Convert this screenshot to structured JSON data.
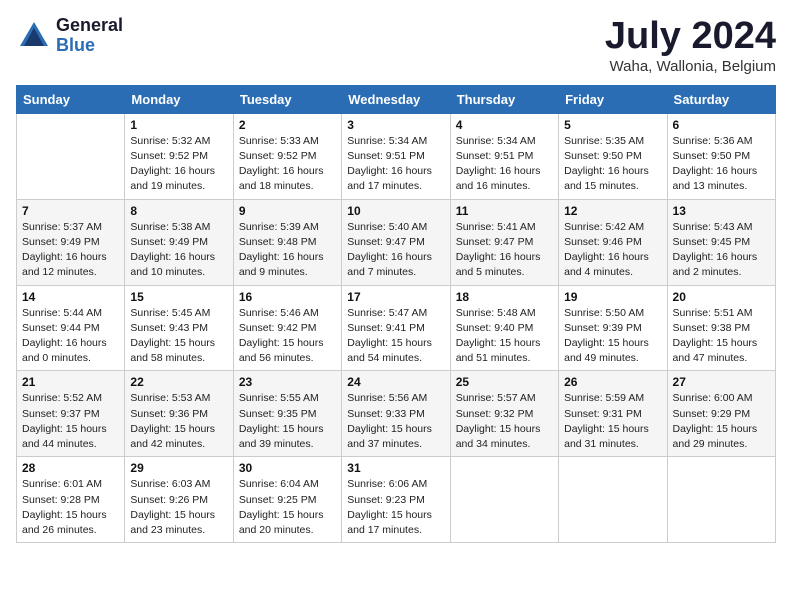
{
  "header": {
    "logo_general": "General",
    "logo_blue": "Blue",
    "title": "July 2024",
    "subtitle": "Waha, Wallonia, Belgium"
  },
  "weekdays": [
    "Sunday",
    "Monday",
    "Tuesday",
    "Wednesday",
    "Thursday",
    "Friday",
    "Saturday"
  ],
  "weeks": [
    [
      {
        "day": "",
        "info": ""
      },
      {
        "day": "1",
        "info": "Sunrise: 5:32 AM\nSunset: 9:52 PM\nDaylight: 16 hours\nand 19 minutes."
      },
      {
        "day": "2",
        "info": "Sunrise: 5:33 AM\nSunset: 9:52 PM\nDaylight: 16 hours\nand 18 minutes."
      },
      {
        "day": "3",
        "info": "Sunrise: 5:34 AM\nSunset: 9:51 PM\nDaylight: 16 hours\nand 17 minutes."
      },
      {
        "day": "4",
        "info": "Sunrise: 5:34 AM\nSunset: 9:51 PM\nDaylight: 16 hours\nand 16 minutes."
      },
      {
        "day": "5",
        "info": "Sunrise: 5:35 AM\nSunset: 9:50 PM\nDaylight: 16 hours\nand 15 minutes."
      },
      {
        "day": "6",
        "info": "Sunrise: 5:36 AM\nSunset: 9:50 PM\nDaylight: 16 hours\nand 13 minutes."
      }
    ],
    [
      {
        "day": "7",
        "info": "Sunrise: 5:37 AM\nSunset: 9:49 PM\nDaylight: 16 hours\nand 12 minutes."
      },
      {
        "day": "8",
        "info": "Sunrise: 5:38 AM\nSunset: 9:49 PM\nDaylight: 16 hours\nand 10 minutes."
      },
      {
        "day": "9",
        "info": "Sunrise: 5:39 AM\nSunset: 9:48 PM\nDaylight: 16 hours\nand 9 minutes."
      },
      {
        "day": "10",
        "info": "Sunrise: 5:40 AM\nSunset: 9:47 PM\nDaylight: 16 hours\nand 7 minutes."
      },
      {
        "day": "11",
        "info": "Sunrise: 5:41 AM\nSunset: 9:47 PM\nDaylight: 16 hours\nand 5 minutes."
      },
      {
        "day": "12",
        "info": "Sunrise: 5:42 AM\nSunset: 9:46 PM\nDaylight: 16 hours\nand 4 minutes."
      },
      {
        "day": "13",
        "info": "Sunrise: 5:43 AM\nSunset: 9:45 PM\nDaylight: 16 hours\nand 2 minutes."
      }
    ],
    [
      {
        "day": "14",
        "info": "Sunrise: 5:44 AM\nSunset: 9:44 PM\nDaylight: 16 hours\nand 0 minutes."
      },
      {
        "day": "15",
        "info": "Sunrise: 5:45 AM\nSunset: 9:43 PM\nDaylight: 15 hours\nand 58 minutes."
      },
      {
        "day": "16",
        "info": "Sunrise: 5:46 AM\nSunset: 9:42 PM\nDaylight: 15 hours\nand 56 minutes."
      },
      {
        "day": "17",
        "info": "Sunrise: 5:47 AM\nSunset: 9:41 PM\nDaylight: 15 hours\nand 54 minutes."
      },
      {
        "day": "18",
        "info": "Sunrise: 5:48 AM\nSunset: 9:40 PM\nDaylight: 15 hours\nand 51 minutes."
      },
      {
        "day": "19",
        "info": "Sunrise: 5:50 AM\nSunset: 9:39 PM\nDaylight: 15 hours\nand 49 minutes."
      },
      {
        "day": "20",
        "info": "Sunrise: 5:51 AM\nSunset: 9:38 PM\nDaylight: 15 hours\nand 47 minutes."
      }
    ],
    [
      {
        "day": "21",
        "info": "Sunrise: 5:52 AM\nSunset: 9:37 PM\nDaylight: 15 hours\nand 44 minutes."
      },
      {
        "day": "22",
        "info": "Sunrise: 5:53 AM\nSunset: 9:36 PM\nDaylight: 15 hours\nand 42 minutes."
      },
      {
        "day": "23",
        "info": "Sunrise: 5:55 AM\nSunset: 9:35 PM\nDaylight: 15 hours\nand 39 minutes."
      },
      {
        "day": "24",
        "info": "Sunrise: 5:56 AM\nSunset: 9:33 PM\nDaylight: 15 hours\nand 37 minutes."
      },
      {
        "day": "25",
        "info": "Sunrise: 5:57 AM\nSunset: 9:32 PM\nDaylight: 15 hours\nand 34 minutes."
      },
      {
        "day": "26",
        "info": "Sunrise: 5:59 AM\nSunset: 9:31 PM\nDaylight: 15 hours\nand 31 minutes."
      },
      {
        "day": "27",
        "info": "Sunrise: 6:00 AM\nSunset: 9:29 PM\nDaylight: 15 hours\nand 29 minutes."
      }
    ],
    [
      {
        "day": "28",
        "info": "Sunrise: 6:01 AM\nSunset: 9:28 PM\nDaylight: 15 hours\nand 26 minutes."
      },
      {
        "day": "29",
        "info": "Sunrise: 6:03 AM\nSunset: 9:26 PM\nDaylight: 15 hours\nand 23 minutes."
      },
      {
        "day": "30",
        "info": "Sunrise: 6:04 AM\nSunset: 9:25 PM\nDaylight: 15 hours\nand 20 minutes."
      },
      {
        "day": "31",
        "info": "Sunrise: 6:06 AM\nSunset: 9:23 PM\nDaylight: 15 hours\nand 17 minutes."
      },
      {
        "day": "",
        "info": ""
      },
      {
        "day": "",
        "info": ""
      },
      {
        "day": "",
        "info": ""
      }
    ]
  ]
}
